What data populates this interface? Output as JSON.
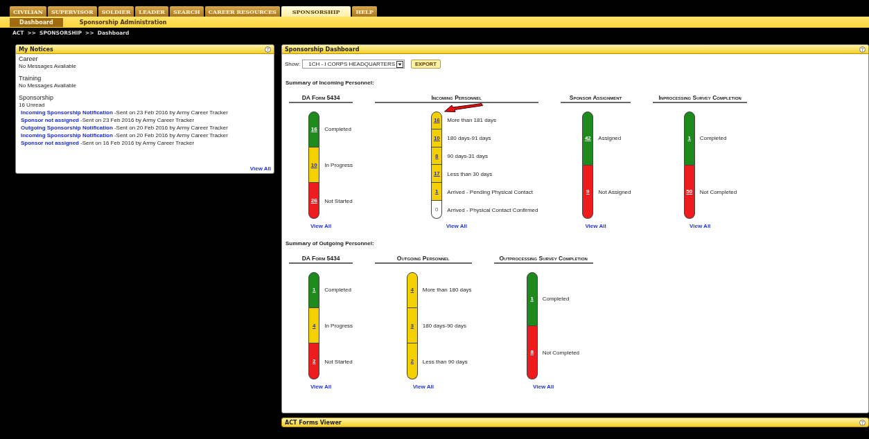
{
  "top_tabs": [
    {
      "label": "CIVILIAN",
      "selected": false
    },
    {
      "label": "SUPERVISOR",
      "selected": false
    },
    {
      "label": "SOLDIER",
      "selected": false
    },
    {
      "label": "LEADER",
      "selected": false
    },
    {
      "label": "SEARCH",
      "selected": false
    },
    {
      "label": "CAREER RESOURCES",
      "selected": false
    },
    {
      "label": "SPONSORSHIP",
      "selected": true
    },
    {
      "label": "HELP",
      "selected": false
    }
  ],
  "sub_tabs": [
    {
      "label": "Dashboard",
      "selected": true
    },
    {
      "label": "Sponsorship Administration",
      "selected": false
    }
  ],
  "breadcrumb": [
    "ACT",
    ">>",
    "SPONSORSHIP",
    ">>",
    "Dashboard"
  ],
  "notices": {
    "title": "My Notices",
    "sections": [
      {
        "heading": "Career",
        "status": "No Messages Available"
      },
      {
        "heading": "Training",
        "status": "No Messages Available"
      },
      {
        "heading": "Sponsorship",
        "status": "16 Unread",
        "messages": [
          {
            "link": "Incoming Sponsorship Notification",
            "text": "-Sent on 23 Feb 2016 by Army Career Tracker"
          },
          {
            "link": "Sponsor not assigned",
            "text": "-Sent on 23 Feb 2016 by Army Career Tracker"
          },
          {
            "link": "Outgoing Sponsorship Notification",
            "text": "-Sent on 20 Feb 2016 by Army Career Tracker"
          },
          {
            "link": "Incoming Sponsorship Notification",
            "text": "-Sent on 20 Feb 2016 by Army Career Tracker"
          },
          {
            "link": "Sponsor not assigned",
            "text": "-Sent on 16 Feb 2016 by Army Career Tracker"
          }
        ]
      }
    ],
    "view_all": "View All"
  },
  "dashboard": {
    "title": "Sponsorship Dashboard",
    "show_label": "Show:",
    "show_value": "1CH - I CORPS HEADQUARTERS",
    "export_button": "EXPORT",
    "summaries": [
      {
        "label": "Summary of Incoming Personnel:",
        "gauges": [
          {
            "title": "DA Form 5434",
            "view_all": "View All",
            "segments": [
              {
                "value": "16",
                "label": "Completed",
                "color": "#1e8a1e"
              },
              {
                "value": "10",
                "label": "In Progress",
                "color": "#f5d000"
              },
              {
                "value": "26",
                "label": "Not Started",
                "color": "#ee1c1c"
              }
            ]
          },
          {
            "title": "Incoming Personnel",
            "view_all": "View All",
            "segments": [
              {
                "value": "16",
                "label": "More than 181 days",
                "color": "#f5d000"
              },
              {
                "value": "10",
                "label": "180 days-91 days",
                "color": "#f5d000"
              },
              {
                "value": "8",
                "label": "90 days-31 days",
                "color": "#f5d000"
              },
              {
                "value": "17",
                "label": "Less than 30 days",
                "color": "#f5d000"
              },
              {
                "value": "1",
                "label": "Arrived - Pending Physical Contact",
                "color": "#f5d000"
              },
              {
                "value": "0",
                "label": "Arrived - Physical Contact Confirmed",
                "color": "#ffffff"
              }
            ]
          },
          {
            "title": "Sponsor Assignment",
            "view_all": "View All",
            "segments": [
              {
                "value": "42",
                "label": "Assigned",
                "color": "#1e8a1e"
              },
              {
                "value": "9",
                "label": "Not Assigned",
                "color": "#ee1c1c"
              }
            ]
          },
          {
            "title": "Inprocessing Survey Completion",
            "view_all": "View All",
            "segments": [
              {
                "value": "1",
                "label": "Completed",
                "color": "#1e8a1e"
              },
              {
                "value": "50",
                "label": "Not Completed",
                "color": "#ee1c1c"
              }
            ]
          }
        ]
      },
      {
        "label": "Summary of Outgoing Personnel:",
        "gauges": [
          {
            "title": "DA Form 5434",
            "view_all": "View All",
            "segments": [
              {
                "value": "1",
                "label": "Completed",
                "color": "#1e8a1e"
              },
              {
                "value": "4",
                "label": "In Progress",
                "color": "#f5d000"
              },
              {
                "value": "2",
                "label": "Not Started",
                "color": "#ee1c1c"
              }
            ]
          },
          {
            "title": "Outgoing Personnel",
            "view_all": "View All",
            "segments": [
              {
                "value": "4",
                "label": "More than 180 days",
                "color": "#f5d000"
              },
              {
                "value": "3",
                "label": "180 days-90 days",
                "color": "#f5d000"
              },
              {
                "value": "2",
                "label": "Less than 90 days",
                "color": "#f5d000"
              }
            ]
          },
          {
            "title": "Outprocessing Survey Completion",
            "view_all": "View All",
            "segments": [
              {
                "value": "1",
                "label": "Completed",
                "color": "#1e8a1e"
              },
              {
                "value": "8",
                "label": "Not Completed",
                "color": "#ee1c1c"
              }
            ]
          }
        ]
      }
    ]
  },
  "forms_viewer": {
    "title": "ACT Forms Viewer"
  }
}
